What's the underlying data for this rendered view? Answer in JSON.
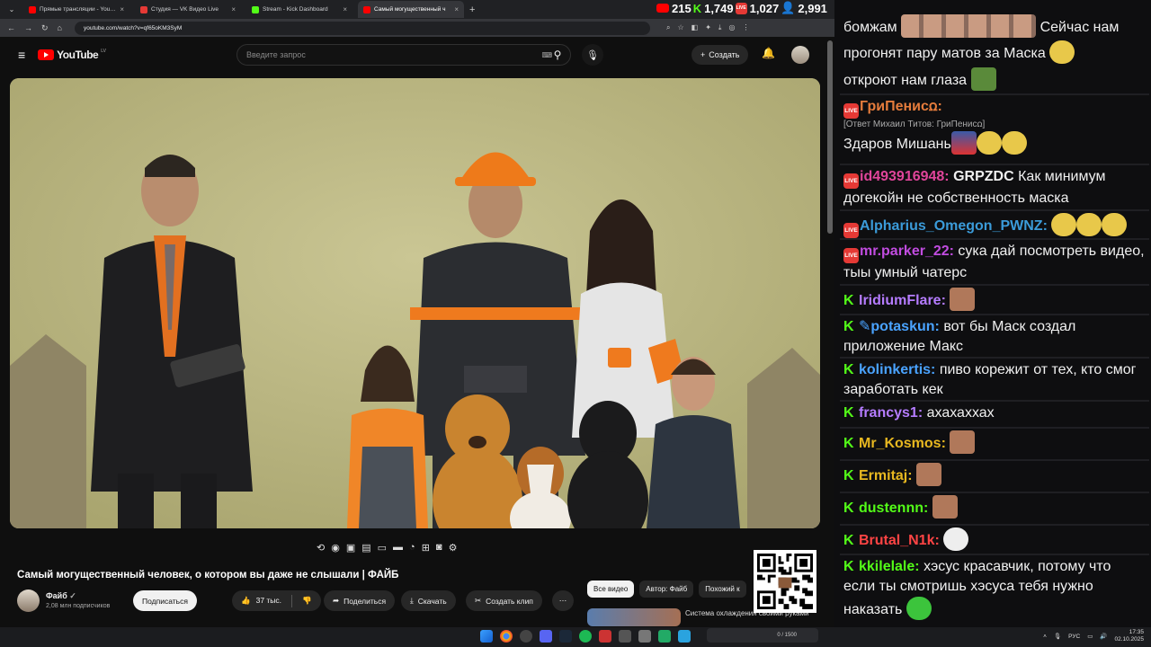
{
  "browser": {
    "tabs": [
      {
        "title": "Прямые трансляции - YouTube",
        "color": "#ff0000",
        "active": false
      },
      {
        "title": "Студия — VK Видео Live",
        "color": "#e53935",
        "active": false
      },
      {
        "title": "Stream - Kick Dashboard",
        "color": "#53fc18",
        "active": false
      },
      {
        "title": "Самый могущественный ч",
        "color": "#ff0000",
        "active": true
      }
    ],
    "url": "youtube.com/watch?v=qf65oKM3SyM"
  },
  "viewers": [
    {
      "platform": "youtube-icon",
      "count": "215",
      "color": "#ff0000"
    },
    {
      "platform": "kick-icon",
      "count": "1,749",
      "color": "#53fc18"
    },
    {
      "platform": "vk-live-icon",
      "count": "1,027",
      "color": "#e53935"
    },
    {
      "platform": "people-icon",
      "count": "2,991",
      "color": "#4aa3ff"
    }
  ],
  "youtube": {
    "logo": "YouTube",
    "logo_country": "LV",
    "search_placeholder": "Введите запрос",
    "create_label": "Создать",
    "video_title": "Самый могущественный человек, о котором вы даже не слышали | ФАЙБ",
    "channel_name": "Файб",
    "channel_subs": "2,08 млн подписчиков",
    "subscribe_label": "Подписаться",
    "likes": "37 тыс.",
    "share_label": "Поделиться",
    "download_label": "Скачать",
    "clip_label": "Создать клип",
    "chips": [
      "Все видео",
      "Автор: Файб",
      "Похожий к"
    ],
    "recommended_title": "Система охлаждения своими руками"
  },
  "chat": {
    "messages": [
      {
        "text": "бомжам",
        "after": "Сейчас нам"
      },
      {
        "text": "прогонят пару матов за Маска"
      },
      {
        "text": "откроют нам глаза"
      },
      {
        "nick": "ГриПенисꭥ:",
        "nick_color": "#e57c3c",
        "reply": "[Ответ Михаил Титов: ГриПенисꭥ]",
        "text": "Здаров Мишань"
      },
      {
        "nick": "id493916948:",
        "nick_color": "#e0459a",
        "bold": "GRPZDC",
        "text": "Как минимум догекойн не собственность маска"
      },
      {
        "nick": "Alpharius_Omegon_PWNZ:",
        "nick_color": "#3b9bd9",
        "text": ""
      },
      {
        "nick": "mr.parker_22:",
        "nick_color": "#c14ce0",
        "text": "сука дай посмотреть видео, тыы умный чатерс"
      },
      {
        "nick": "IridiumFlare:",
        "nick_color": "#b57cff",
        "text": ""
      },
      {
        "nick": "potaskun:",
        "nick_color": "#4aa3ff",
        "text": "вот бы Маск создал приложение Макс"
      },
      {
        "nick": "kolinkertis:",
        "nick_color": "#4aa3ff",
        "text": "пиво корежит от тех, кто смог заработать кек"
      },
      {
        "nick": "francys1:",
        "nick_color": "#b57cff",
        "text": "ахахаххах"
      },
      {
        "nick": "Mr_Kosmos:",
        "nick_color": "#e8b820",
        "text": ""
      },
      {
        "nick": "Ermitaj:",
        "nick_color": "#e8b820",
        "text": ""
      },
      {
        "nick": "dustennn:",
        "nick_color": "#53fc18",
        "text": ""
      },
      {
        "nick": "Brutal_N1k:",
        "nick_color": "#ff4444",
        "text": ""
      },
      {
        "nick": "kkilelale:",
        "nick_color": "#53fc18",
        "text": "хэсус красавчик, потому что если ты смотришь хэсуса тебя нужно наказать"
      }
    ]
  },
  "taskbar": {
    "lang": "РУС",
    "time": "17:35",
    "date": "02.10.2025",
    "widget": "0 / 1500"
  }
}
